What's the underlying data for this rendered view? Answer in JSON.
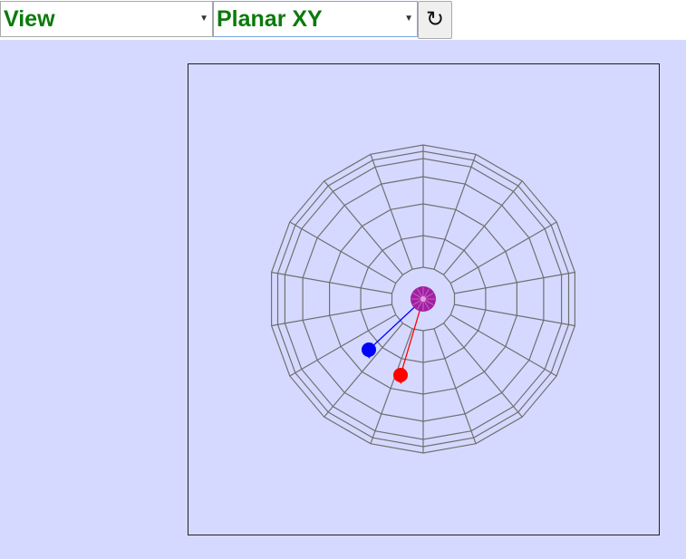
{
  "toolbar": {
    "view_select": {
      "value": "View"
    },
    "mode_select": {
      "value": "Planar XY"
    },
    "reset_button": {
      "icon": "rotate-icon",
      "glyph": "↻"
    }
  },
  "scene": {
    "background_color": "#d5d9ff",
    "mesh_color": "#707070",
    "center_sphere_color": "#a020a0",
    "vectors": [
      {
        "name": "blue-vector",
        "color": "#0000ff"
      },
      {
        "name": "red-vector",
        "color": "#ff0000"
      }
    ]
  }
}
